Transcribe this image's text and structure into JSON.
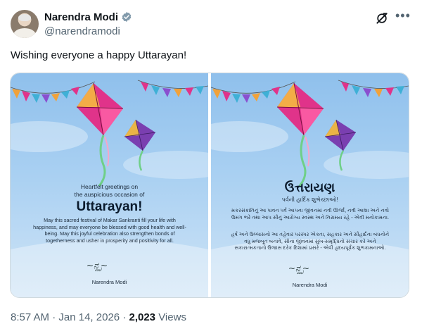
{
  "author": {
    "name": "Narendra Modi",
    "handle": "@narendramodi"
  },
  "tweet": {
    "text": "Wishing everyone a happy Uttarayan!",
    "time": "8:57 AM",
    "separator": "·",
    "date": "Jan 14, 2026",
    "views_count": "2,023",
    "views_label": "Views"
  },
  "media": {
    "left": {
      "greeting_line1": "Heartfelt greetings on",
      "greeting_line2": "the auspicious occasion of",
      "title": "Uttarayan!",
      "message": "May this sacred festival of Makar Sankranti fill your life with happiness, and may everyone be blessed with good health and well-being. May this joyful celebration also strengthen bonds of togetherness and usher in prosperity and positivity for all.",
      "signature_name": "Narendra Modi"
    },
    "right": {
      "title": "ઉત્તરાયણ",
      "subtitle": "પર્વની હાર્દિક શુભેચ્છાઓ!",
      "paragraph1": "મકરસંક્રાંતિનું આ પાવન પર્વ આપના જીવનમાં નવી ઊર્જા, નવી આશા અને નવો ઉમંગ ભરે તથા આપ સૌનું આરોગ્ય સ્વસ્થ અને નિરામય રહે - એવી મનોકામના.",
      "paragraph2": "હર્ષ અને ઉલ્લાસનો આ તહેવાર પરસ્પર એકતા, સહકાર અને સૌહાર્દના બંધનોને વધુ મજબૂત બનાવે, સૌના જીવનમાં સુખ-સમૃદ્ધિનો સંચાર કરે અને સકારાત્મકતાનો ઉજાસ દરેક દિશામાં પ્રસરે - એવી હૃદયપૂર્વક શુભકામનાઓ.",
      "signature_name": "Narendra Modi"
    }
  },
  "icons": {
    "verified": "verified-badge-icon",
    "grok": "grok-icon",
    "more": "more-options-icon"
  },
  "colors": {
    "text_primary": "#0f1419",
    "text_secondary": "#536471",
    "sky_top": "#8fc0ec",
    "kite_pink": "#e0338a",
    "kite_purple": "#7a3fb0",
    "kite_yellow": "#f6c23b"
  }
}
